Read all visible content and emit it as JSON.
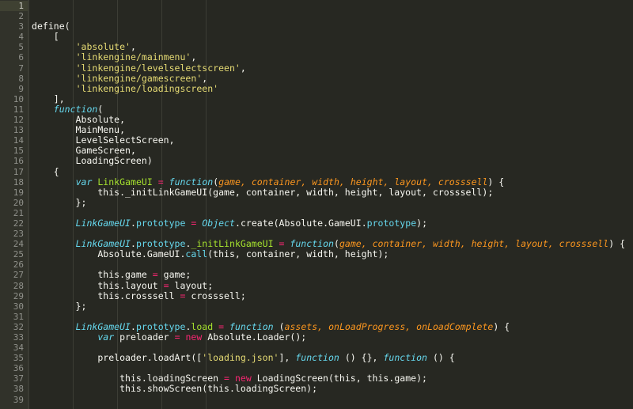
{
  "editor": {
    "theme_name": "monokai",
    "colors": {
      "background": "#272822",
      "gutter_background": "#31322a",
      "active_gutter_background": "#3f4132",
      "foreground": "#f8f8f2",
      "line_number": "#90918b",
      "string": "#e6db74",
      "keyword": "#66d9ef",
      "function_name": "#a6e22e",
      "operator": "#f92672",
      "parameter": "#fd971f",
      "property": "#66d9ef",
      "indent_guide": "#3c3d35"
    },
    "active_line": 1,
    "first_visible_line": 1,
    "last_visible_line": 39,
    "language": "JavaScript"
  },
  "code": {
    "lines": [
      {
        "n": "1",
        "tokens": []
      },
      {
        "n": "2",
        "tokens": []
      },
      {
        "n": "3",
        "tokens": [
          {
            "t": "plain",
            "s": "define("
          }
        ]
      },
      {
        "n": "4",
        "tokens": [
          {
            "t": "plain",
            "s": "    ["
          }
        ]
      },
      {
        "n": "5",
        "tokens": [
          {
            "t": "plain",
            "s": "        "
          },
          {
            "t": "str",
            "s": "'absolute'"
          },
          {
            "t": "punc",
            "s": ","
          }
        ]
      },
      {
        "n": "6",
        "tokens": [
          {
            "t": "plain",
            "s": "        "
          },
          {
            "t": "str",
            "s": "'linkengine/mainmenu'"
          },
          {
            "t": "punc",
            "s": ","
          }
        ]
      },
      {
        "n": "7",
        "tokens": [
          {
            "t": "plain",
            "s": "        "
          },
          {
            "t": "str",
            "s": "'linkengine/levelselectscreen'"
          },
          {
            "t": "punc",
            "s": ","
          }
        ]
      },
      {
        "n": "8",
        "tokens": [
          {
            "t": "plain",
            "s": "        "
          },
          {
            "t": "str",
            "s": "'linkengine/gamescreen'"
          },
          {
            "t": "punc",
            "s": ","
          }
        ]
      },
      {
        "n": "9",
        "tokens": [
          {
            "t": "plain",
            "s": "        "
          },
          {
            "t": "str",
            "s": "'linkengine/loadingscreen'"
          }
        ]
      },
      {
        "n": "10",
        "tokens": [
          {
            "t": "plain",
            "s": "    ],"
          }
        ]
      },
      {
        "n": "11",
        "tokens": [
          {
            "t": "plain",
            "s": "    "
          },
          {
            "t": "kw",
            "s": "function"
          },
          {
            "t": "punc",
            "s": "("
          }
        ]
      },
      {
        "n": "12",
        "tokens": [
          {
            "t": "plain",
            "s": "        Absolute,"
          }
        ]
      },
      {
        "n": "13",
        "tokens": [
          {
            "t": "plain",
            "s": "        MainMenu,"
          }
        ]
      },
      {
        "n": "14",
        "tokens": [
          {
            "t": "plain",
            "s": "        LevelSelectScreen,"
          }
        ]
      },
      {
        "n": "15",
        "tokens": [
          {
            "t": "plain",
            "s": "        GameScreen,"
          }
        ]
      },
      {
        "n": "16",
        "tokens": [
          {
            "t": "plain",
            "s": "        LoadingScreen)"
          }
        ]
      },
      {
        "n": "17",
        "tokens": [
          {
            "t": "plain",
            "s": "    {"
          }
        ]
      },
      {
        "n": "18",
        "tokens": [
          {
            "t": "plain",
            "s": "        "
          },
          {
            "t": "kw",
            "s": "var"
          },
          {
            "t": "plain",
            "s": " "
          },
          {
            "t": "fn",
            "s": "LinkGameUI"
          },
          {
            "t": "plain",
            "s": " "
          },
          {
            "t": "op",
            "s": "="
          },
          {
            "t": "plain",
            "s": " "
          },
          {
            "t": "kw",
            "s": "function"
          },
          {
            "t": "punc",
            "s": "("
          },
          {
            "t": "param",
            "s": "game, container, width, height, layout, crosssell"
          },
          {
            "t": "punc",
            "s": ") {"
          }
        ]
      },
      {
        "n": "19",
        "tokens": [
          {
            "t": "plain",
            "s": "            this._initLinkGameUI(game, container, width, height, layout, crosssell);"
          }
        ]
      },
      {
        "n": "20",
        "tokens": [
          {
            "t": "plain",
            "s": "        };"
          }
        ]
      },
      {
        "n": "21",
        "tokens": []
      },
      {
        "n": "22",
        "tokens": [
          {
            "t": "plain",
            "s": "        "
          },
          {
            "t": "cls",
            "s": "LinkGameUI"
          },
          {
            "t": "punc",
            "s": "."
          },
          {
            "t": "prop",
            "s": "prototype"
          },
          {
            "t": "plain",
            "s": " "
          },
          {
            "t": "op",
            "s": "="
          },
          {
            "t": "plain",
            "s": " "
          },
          {
            "t": "cls",
            "s": "Object"
          },
          {
            "t": "punc",
            "s": "."
          },
          {
            "t": "plain",
            "s": "create(Absolute.GameUI."
          },
          {
            "t": "prop",
            "s": "prototype"
          },
          {
            "t": "punc",
            "s": ");"
          }
        ]
      },
      {
        "n": "23",
        "tokens": []
      },
      {
        "n": "24",
        "tokens": [
          {
            "t": "plain",
            "s": "        "
          },
          {
            "t": "cls",
            "s": "LinkGameUI"
          },
          {
            "t": "punc",
            "s": "."
          },
          {
            "t": "prop",
            "s": "prototype"
          },
          {
            "t": "punc",
            "s": "."
          },
          {
            "t": "fn",
            "s": "_initLinkGameUI"
          },
          {
            "t": "plain",
            "s": " "
          },
          {
            "t": "op",
            "s": "="
          },
          {
            "t": "plain",
            "s": " "
          },
          {
            "t": "kw",
            "s": "function"
          },
          {
            "t": "punc",
            "s": "("
          },
          {
            "t": "param",
            "s": "game, container, width, height, layout, crosssell"
          },
          {
            "t": "punc",
            "s": ") {"
          }
        ]
      },
      {
        "n": "25",
        "tokens": [
          {
            "t": "plain",
            "s": "            Absolute.GameUI."
          },
          {
            "t": "prop",
            "s": "call"
          },
          {
            "t": "punc",
            "s": "("
          },
          {
            "t": "plain",
            "s": "this, container, width, height);"
          }
        ]
      },
      {
        "n": "26",
        "tokens": []
      },
      {
        "n": "27",
        "tokens": [
          {
            "t": "plain",
            "s": "            this.game "
          },
          {
            "t": "op",
            "s": "="
          },
          {
            "t": "plain",
            "s": " game;"
          }
        ]
      },
      {
        "n": "28",
        "tokens": [
          {
            "t": "plain",
            "s": "            this.layout "
          },
          {
            "t": "op",
            "s": "="
          },
          {
            "t": "plain",
            "s": " layout;"
          }
        ]
      },
      {
        "n": "29",
        "tokens": [
          {
            "t": "plain",
            "s": "            this.crosssell "
          },
          {
            "t": "op",
            "s": "="
          },
          {
            "t": "plain",
            "s": " crosssell;"
          }
        ]
      },
      {
        "n": "30",
        "tokens": [
          {
            "t": "plain",
            "s": "        };"
          }
        ]
      },
      {
        "n": "31",
        "tokens": []
      },
      {
        "n": "32",
        "tokens": [
          {
            "t": "plain",
            "s": "        "
          },
          {
            "t": "cls",
            "s": "LinkGameUI"
          },
          {
            "t": "punc",
            "s": "."
          },
          {
            "t": "prop",
            "s": "prototype"
          },
          {
            "t": "punc",
            "s": "."
          },
          {
            "t": "fn",
            "s": "load"
          },
          {
            "t": "plain",
            "s": " "
          },
          {
            "t": "op",
            "s": "="
          },
          {
            "t": "plain",
            "s": " "
          },
          {
            "t": "kw",
            "s": "function"
          },
          {
            "t": "plain",
            "s": " "
          },
          {
            "t": "punc",
            "s": "("
          },
          {
            "t": "param",
            "s": "assets, onLoadProgress, onLoadComplete"
          },
          {
            "t": "punc",
            "s": ") {"
          }
        ]
      },
      {
        "n": "33",
        "tokens": [
          {
            "t": "plain",
            "s": "            "
          },
          {
            "t": "kw",
            "s": "var"
          },
          {
            "t": "plain",
            "s": " preloader "
          },
          {
            "t": "op",
            "s": "="
          },
          {
            "t": "plain",
            "s": " "
          },
          {
            "t": "op",
            "s": "new"
          },
          {
            "t": "plain",
            "s": " Absolute.Loader();"
          }
        ]
      },
      {
        "n": "34",
        "tokens": []
      },
      {
        "n": "35",
        "tokens": [
          {
            "t": "plain",
            "s": "            preloader.loadArt(["
          },
          {
            "t": "str",
            "s": "'loading.json'"
          },
          {
            "t": "plain",
            "s": "], "
          },
          {
            "t": "kw",
            "s": "function"
          },
          {
            "t": "plain",
            "s": " () {}, "
          },
          {
            "t": "kw",
            "s": "function"
          },
          {
            "t": "plain",
            "s": " () {"
          }
        ]
      },
      {
        "n": "36",
        "tokens": []
      },
      {
        "n": "37",
        "tokens": [
          {
            "t": "plain",
            "s": "                this.loadingScreen "
          },
          {
            "t": "op",
            "s": "="
          },
          {
            "t": "plain",
            "s": " "
          },
          {
            "t": "op",
            "s": "new"
          },
          {
            "t": "plain",
            "s": " LoadingScreen(this, this.game);"
          }
        ]
      },
      {
        "n": "38",
        "tokens": [
          {
            "t": "plain",
            "s": "                this.showScreen(this.loadingScreen);"
          }
        ]
      },
      {
        "n": "39",
        "tokens": []
      }
    ],
    "indent_guide_x": [
      36,
      92,
      148,
      204,
      260
    ]
  }
}
